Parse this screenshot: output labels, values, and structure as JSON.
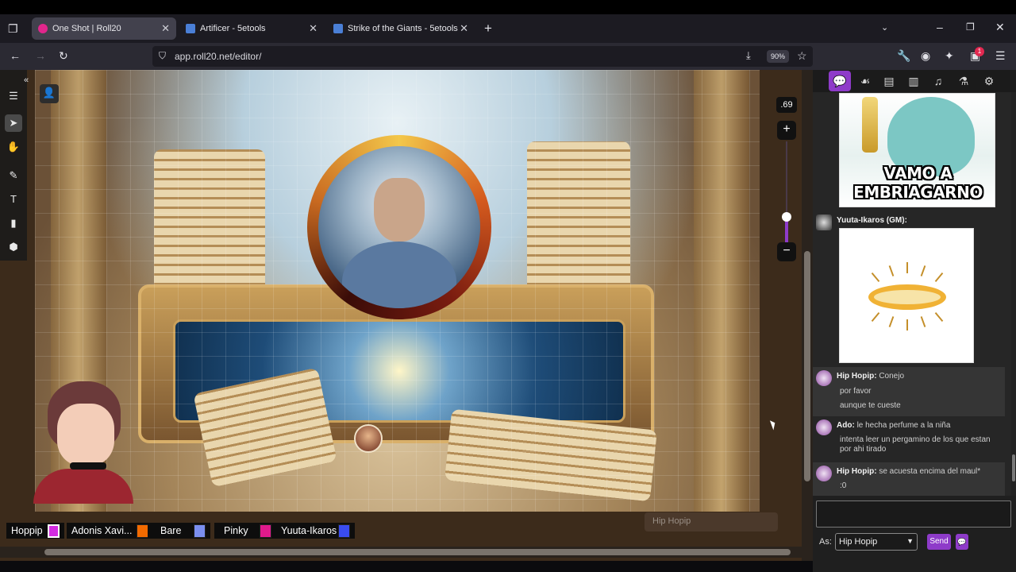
{
  "browser": {
    "tabs": [
      {
        "label": "One Shot | Roll20",
        "active": true,
        "favicon_color": "#e1268c"
      },
      {
        "label": "Artificer - 5etools",
        "active": false,
        "favicon_color": "#4a7fd6"
      },
      {
        "label": "Strike of the Giants - 5etools",
        "active": false,
        "favicon_color": "#4a7fd6"
      }
    ],
    "url": "app.roll20.net/editor/",
    "zoom": "90%",
    "notification_count": "1"
  },
  "editor": {
    "zoom_level": ".69",
    "zoom_slider_value": 0.69,
    "typing_indicator": "Hip Hopip",
    "players": [
      {
        "name": "Hoppip",
        "color": "#d32be0"
      },
      {
        "name": "Adonis Xavi...",
        "color": "#f26a00"
      },
      {
        "name": "Bare",
        "color": "#7b8ff0"
      },
      {
        "name": "Pinky",
        "color": "#e01a8c"
      },
      {
        "name": "Yuuta-Ikaros",
        "color": "#3a4cf0"
      }
    ]
  },
  "chat": {
    "meme_text_line1": "VAMO A",
    "meme_text_line2": "EMBRIAGARNO",
    "gm_name": "Yuuta-Ikaros (GM):",
    "messages": [
      {
        "name": "Hip Hopip:",
        "lines": [
          "Conejo",
          "por favor",
          "aunque te cueste"
        ]
      },
      {
        "name": "Ado:",
        "lines": [
          "le hecha perfume a la niña",
          "intenta leer un pergamino de los que estan por ahi tirado"
        ]
      },
      {
        "name": "Hip Hopip:",
        "lines": [
          "se acuesta encima del maul*",
          ":0"
        ]
      }
    ],
    "as_label": "As:",
    "as_value": "Hip Hopip",
    "send_label": "Send"
  },
  "icons": {
    "left_tools": [
      "menu-icon",
      "select-icon",
      "pan-icon",
      "draw-icon",
      "text-icon",
      "ruler-icon",
      "dice-icon"
    ],
    "sidebar_tabs": [
      "chat-icon",
      "art-icon",
      "journal-icon",
      "compendium-icon",
      "jukebox-icon",
      "collections-icon",
      "settings-icon"
    ]
  }
}
